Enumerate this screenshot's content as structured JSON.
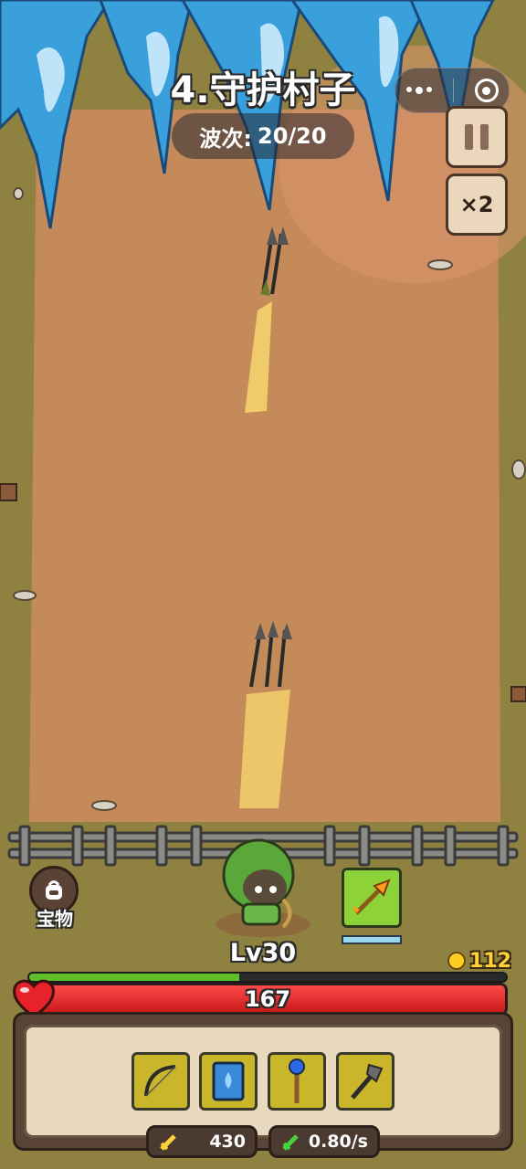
{
  "level_title": "4.守护村子",
  "wave": {
    "label": "波次:",
    "value": "20/20"
  },
  "menu": {
    "more_icon": "more-dots-icon",
    "close_icon": "target-close-icon"
  },
  "controls": {
    "pause_icon": "pause-icon",
    "speed_label": "×2"
  },
  "treasure": {
    "icon": "backpack-icon",
    "label": "宝物"
  },
  "hero": {
    "level": "Lv30",
    "xp_fraction": 0.44
  },
  "gold": {
    "icon": "gold-coin-icon",
    "value": "112"
  },
  "health": {
    "value": "167",
    "fraction": 1.0,
    "icon": "heart-icon"
  },
  "skill": {
    "icon": "golden-arrow-skill-icon",
    "cooldown_fraction": 1.0
  },
  "equipment": [
    {
      "icon": "bow-icon"
    },
    {
      "icon": "water-spellbook-icon"
    },
    {
      "icon": "blue-orb-staff-icon"
    },
    {
      "icon": "axe-icon"
    }
  ],
  "stats": [
    {
      "icon": "attack-sword-icon",
      "value": "430"
    },
    {
      "icon": "attack-speed-icon",
      "value": "0.80/s"
    }
  ],
  "colors": {
    "hp": "#e02020",
    "xp": "#5fbf2a",
    "gold": "#ffd23a",
    "slot": "#c9b62a",
    "ground": "#c48a5a"
  }
}
